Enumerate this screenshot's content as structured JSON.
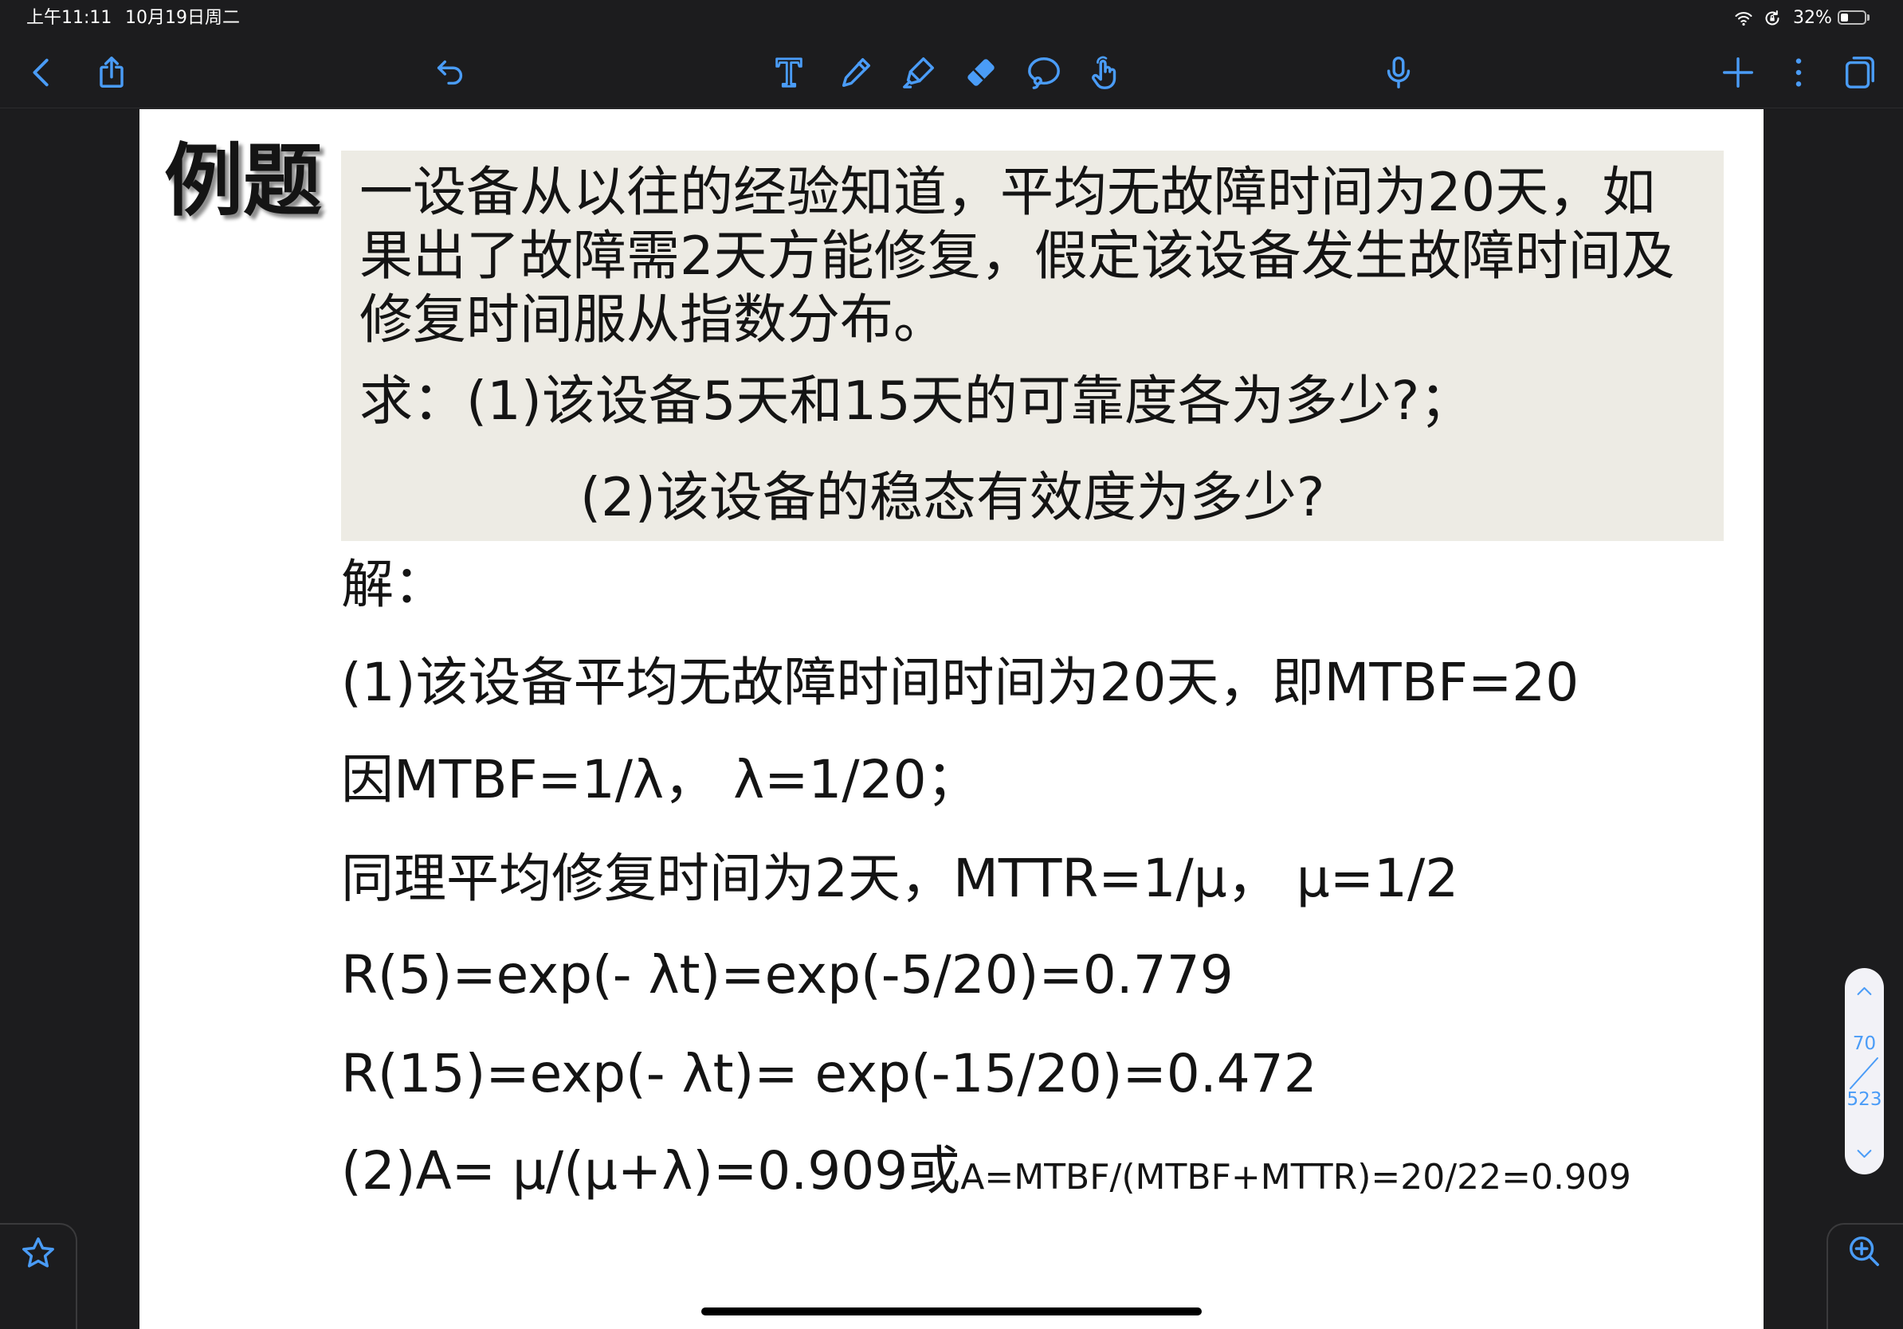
{
  "status_bar": {
    "time": "上午11:11",
    "date": "10月19日周二",
    "battery_text": "32%",
    "battery_level": 0.32,
    "icons": [
      "wifi-icon",
      "orientation-lock-icon",
      "battery-icon"
    ]
  },
  "toolbar": {
    "left_icons": [
      "back-icon",
      "share-icon",
      "undo-icon"
    ],
    "tool_icons": [
      "text-tool-icon",
      "pen-icon",
      "highlighter-icon",
      "eraser-icon",
      "lasso-icon",
      "hand-pointer-icon"
    ],
    "center_icons": [
      "microphone-icon"
    ],
    "right_icons": [
      "add-icon",
      "more-icon",
      "pages-icon"
    ]
  },
  "page": {
    "title": "例题",
    "problem": {
      "lines": [
        "一设备从以往的经验知道，平均无故障时间为20天，如",
        "果出了故障需2天方能修复，假定该设备发生故障时间及",
        "修复时间服从指数分布。"
      ],
      "question_1": "求：(1)该设备5天和15天的可靠度各为多少?；",
      "question_2": "(2)该设备的稳态有效度为多少?"
    },
    "solution": {
      "heading": "解：",
      "lines": [
        "(1)该设备平均无故障时间时间为20天，即MTBF=20",
        "因MTBF=1/λ， λ=1/20；",
        "同理平均修复时间为2天，MTTR=1/μ， μ=1/2",
        "R(5)=exp(- λt)=exp(-5/20)=0.779",
        "R(15)=exp(- λt)= exp(-15/20)=0.472"
      ],
      "final_line": {
        "main": "(2)A= μ/(μ+λ)=0.909或",
        "alt": "A=MTBF/(MTBF+MTTR)=20/22=0.909"
      }
    }
  },
  "page_scrubber": {
    "current_page": "70",
    "total_pages": "523",
    "icons": [
      "chevron-up-icon",
      "chevron-down-icon"
    ]
  },
  "bottom_controls": {
    "left_icon": "star-icon",
    "right_icon": "zoom-in-icon"
  },
  "colors": {
    "accent": "#4a9cf7",
    "app_background": "#1c1c1e",
    "page_background": "#ffffff",
    "problem_box": "#edebe4",
    "text": "#141414"
  }
}
